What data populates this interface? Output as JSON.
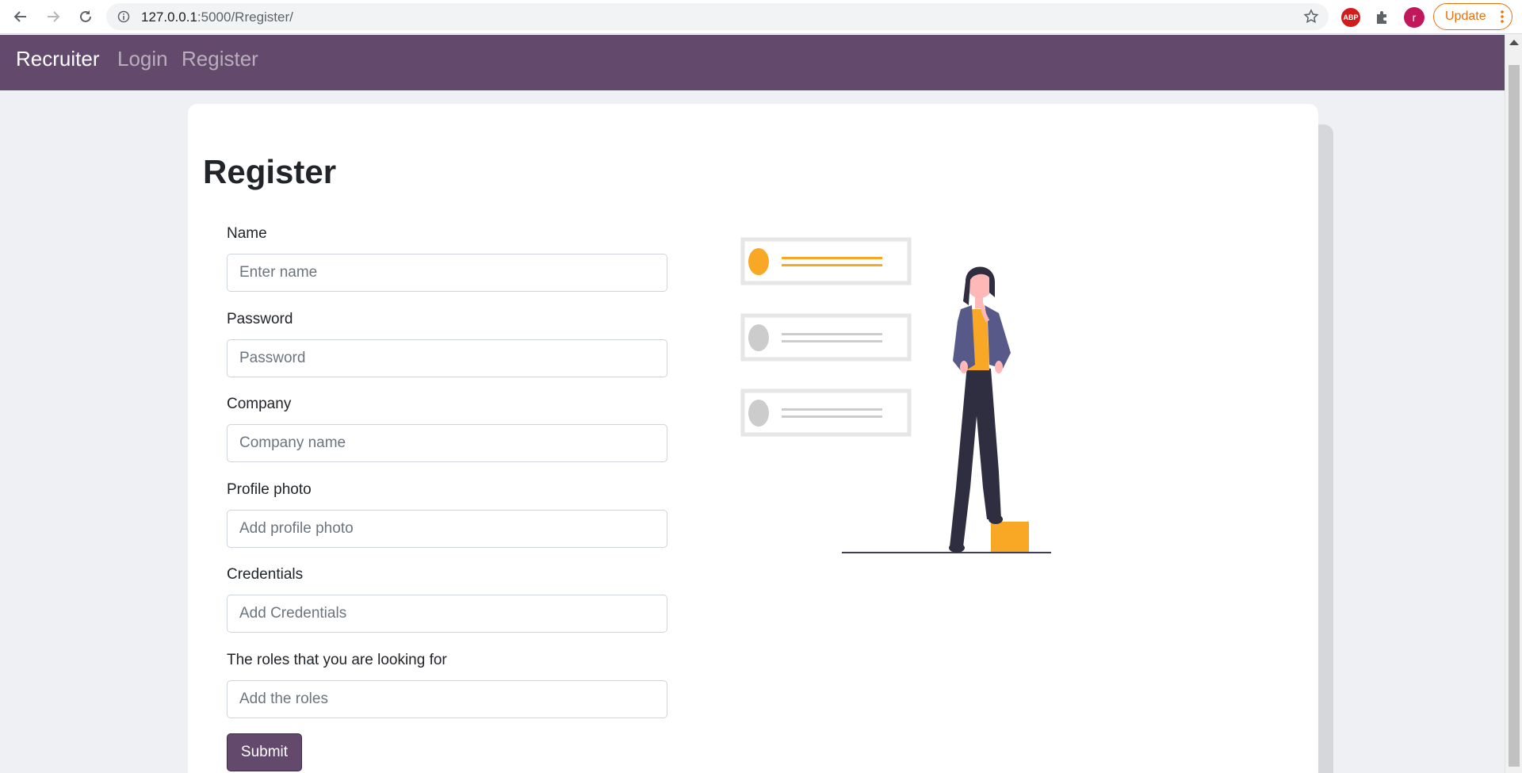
{
  "browser": {
    "url_host": "127.0.0.1",
    "url_path": ":5000/Rregister/",
    "ext_abp": "ABP",
    "avatar_letter": "r",
    "update_label": "Update"
  },
  "navbar": {
    "brand": "Recruiter",
    "links": [
      "Login",
      "Register"
    ]
  },
  "form": {
    "title": "Register",
    "fields": [
      {
        "label": "Name",
        "placeholder": "Enter name"
      },
      {
        "label": "Password",
        "placeholder": "Password"
      },
      {
        "label": "Company",
        "placeholder": "Company name"
      },
      {
        "label": "Profile photo",
        "placeholder": "Add profile photo"
      },
      {
        "label": "Credentials",
        "placeholder": "Add Credentials"
      },
      {
        "label": "The roles that you are looking for",
        "placeholder": "Add the roles"
      }
    ],
    "submit_label": "Submit"
  },
  "colors": {
    "navbar": "#634a6c",
    "accent": "#f9a826",
    "update": "#e8710a"
  }
}
